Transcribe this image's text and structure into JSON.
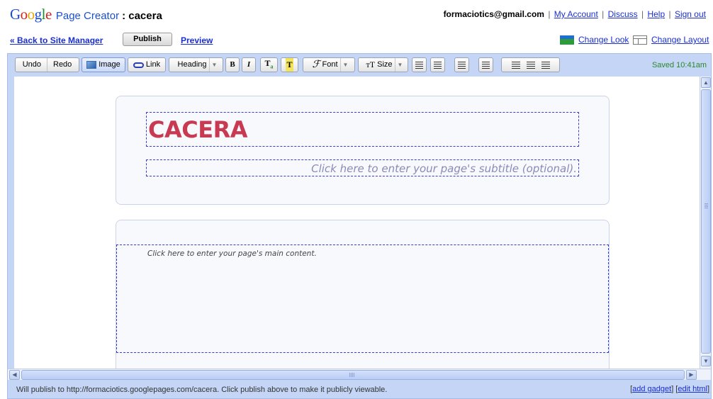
{
  "header": {
    "brand_letters": [
      "G",
      "o",
      "o",
      "g",
      "l",
      "e"
    ],
    "product_name": "Page Creator",
    "site_name_prefix": ":",
    "site_name": "cacera",
    "account_email": "formaciotics@gmail.com",
    "links": {
      "my_account": "My Account",
      "discuss": "Discuss",
      "help": "Help",
      "sign_out": "Sign out"
    },
    "separator": "|"
  },
  "nav": {
    "back_label": "« Back to Site Manager",
    "publish_label": "Publish",
    "preview_label": "Preview",
    "change_look_label": "Change Look",
    "change_layout_label": "Change Layout"
  },
  "toolbar": {
    "undo": "Undo",
    "redo": "Redo",
    "image": "Image",
    "link": "Link",
    "heading": "Heading",
    "bold": "B",
    "italic": "I",
    "font": "Font",
    "size": "Size",
    "saved_status": "Saved 10:41am"
  },
  "page": {
    "title": "CACERA",
    "subtitle_placeholder": "Click here to enter your page's subtitle (optional).",
    "content_placeholder": "Click here to enter your page's main content."
  },
  "status": {
    "publish_message": "Will publish to http://formaciotics.googlepages.com/cacera. Click publish above to make it publicly viewable.",
    "add_gadget": "add gadget",
    "edit_html": "edit html"
  },
  "colors": {
    "title": "#c83a52",
    "link": "#1a2fd0",
    "frame": "#c4d5f5",
    "saved": "#2a8a2a"
  }
}
